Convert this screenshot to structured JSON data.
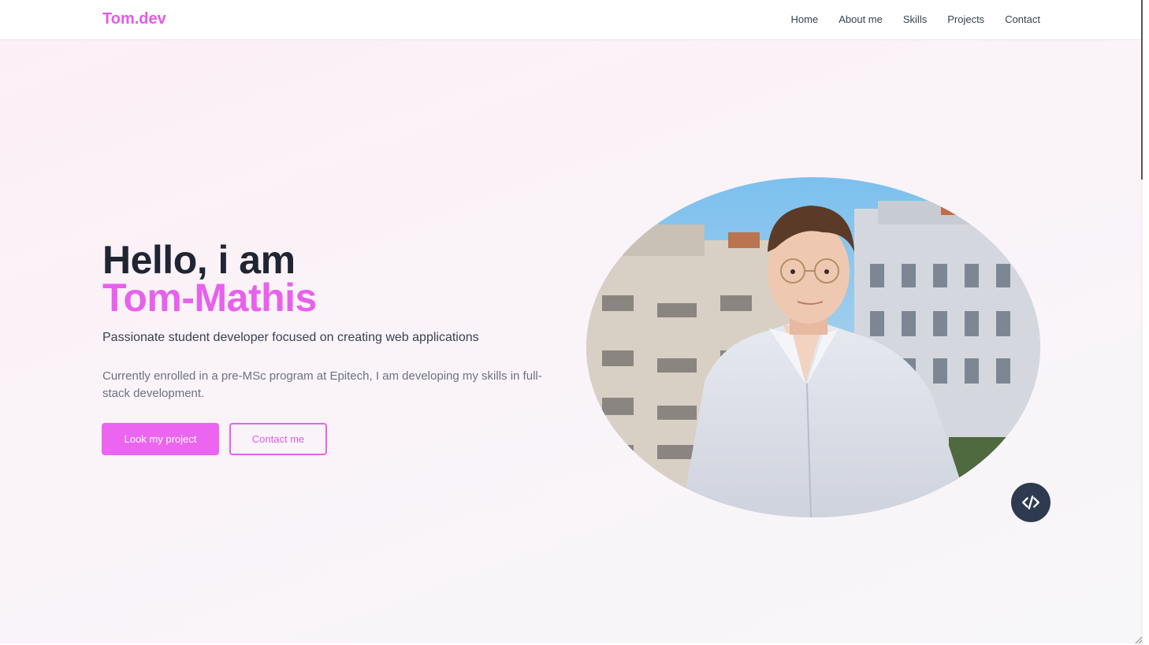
{
  "nav": {
    "brand": "Tom.dev",
    "links": [
      "Home",
      "About me",
      "Skills",
      "Projects",
      "Contact"
    ]
  },
  "hero": {
    "greeting": "Hello, i am",
    "name": "Tom-Mathis",
    "tagline": "Passionate student developer focused on creating web applications",
    "description": "Currently enrolled in a pre-MSc program at Epitech, I am developing my skills in full-stack development.",
    "primary_button": "Look my project",
    "secondary_button": "Contact me"
  },
  "icons": {
    "badge": "code-icon"
  },
  "colors": {
    "accent": "#e861ec",
    "heading": "#1f2533",
    "badge_bg": "#2e3a50"
  }
}
